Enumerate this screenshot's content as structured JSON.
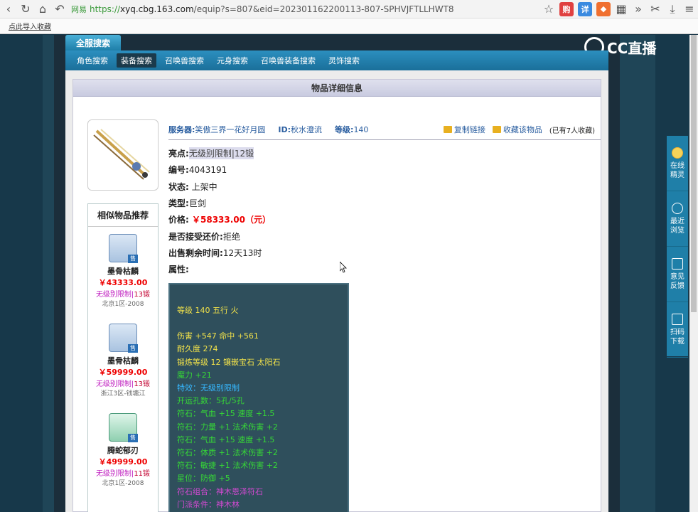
{
  "browser": {
    "url_prefix": "https://",
    "url_host": "xyq.cbg.163.com",
    "url_path": "/equip?s=807&eid=202301162200113-807-SPHVJFTLLHWT8",
    "secure_label": "网易",
    "bookmark": "点此导入收藏",
    "ext_labels": [
      "购",
      "详"
    ]
  },
  "brand": {
    "logo": "CC直播"
  },
  "tabs": {
    "quan": "全服搜索",
    "nav": [
      "角色搜索",
      "装备搜索",
      "召唤兽搜索",
      "元身搜索",
      "召唤兽装备搜索",
      "灵饰搜索"
    ]
  },
  "detail": {
    "header": "物品详细信息",
    "server_label": "服务器:",
    "server": "笑傲三界一花好月圆",
    "id_label": "ID:",
    "id": "秋水澄流",
    "level_label": "等级:",
    "level": "140",
    "copy_link": "复制链接",
    "collect": "收藏该物品",
    "collect_count": "(已有7人收藏)",
    "fields": [
      {
        "k": "亮点:",
        "v": "无级别限制|12锻",
        "style": "hl"
      },
      {
        "k": "编号:",
        "v": "4043191",
        "style": ""
      },
      {
        "k": "状态:",
        "v": " 上架中",
        "style": ""
      },
      {
        "k": "类型:",
        "v": "巨剑",
        "style": ""
      },
      {
        "k": "价格:",
        "v": " ￥58333.00（元）",
        "style": "price"
      },
      {
        "k": "是否接受还价:",
        "v": "拒绝",
        "style": ""
      },
      {
        "k": "出售剩余时间:",
        "v": "12天13时",
        "style": ""
      },
      {
        "k": "属性:",
        "v": "",
        "style": ""
      }
    ],
    "attrs": [
      {
        "t": "等级 140 五行 火",
        "c": "yel"
      },
      {
        "t": "",
        "c": "yel"
      },
      {
        "t": "伤害 +547 命中 +561",
        "c": "yel"
      },
      {
        "t": "耐久度 274",
        "c": "yel"
      },
      {
        "t": "锻炼等级 12 镶嵌宝石 太阳石",
        "c": "yel"
      },
      {
        "t": "魔力 +21",
        "c": "grn"
      },
      {
        "t": "特效：无级别限制",
        "c": "cyan"
      },
      {
        "t": "开运孔数：5孔/5孔",
        "c": "grn"
      },
      {
        "t": "符石：气血 +15 速度 +1.5",
        "c": "grn"
      },
      {
        "t": "符石：力量 +1 法术伤害 +2",
        "c": "grn"
      },
      {
        "t": "符石：气血 +15 速度 +1.5",
        "c": "grn"
      },
      {
        "t": "符石：体质 +1 法术伤害 +2",
        "c": "grn"
      },
      {
        "t": "符石：敏捷 +1 法术伤害 +2",
        "c": "grn"
      },
      {
        "t": "星位：防御 +5",
        "c": "grn"
      },
      {
        "t": "符石组合：神木恩泽符石",
        "c": "pink"
      },
      {
        "t": "门派条件：神木林",
        "c": "pink"
      }
    ]
  },
  "recommend": {
    "title": "相似物品推荐",
    "items": [
      {
        "name": "墨骨枯麟",
        "price": "￥43333.00",
        "tag": "无级别限制|",
        "lvl": "13锻",
        "server": "北京1区-2008",
        "badge": "售"
      },
      {
        "name": "墨骨枯麟",
        "price": "￥59999.00",
        "tag": "无级别限制|",
        "lvl": "13锻",
        "server": "浙江3区-钱塘江",
        "badge": "售"
      },
      {
        "name": "腾蛇郁刃",
        "price": "￥49999.00",
        "tag": "无级别限制|",
        "lvl": "11锻",
        "server": "北京1区-2008",
        "badge": "售"
      }
    ]
  },
  "side": [
    {
      "l1": "在线",
      "l2": "精灵"
    },
    {
      "l1": "最近",
      "l2": "浏览"
    },
    {
      "l1": "意见",
      "l2": "反馈"
    },
    {
      "l1": "扫码",
      "l2": "下载"
    }
  ]
}
